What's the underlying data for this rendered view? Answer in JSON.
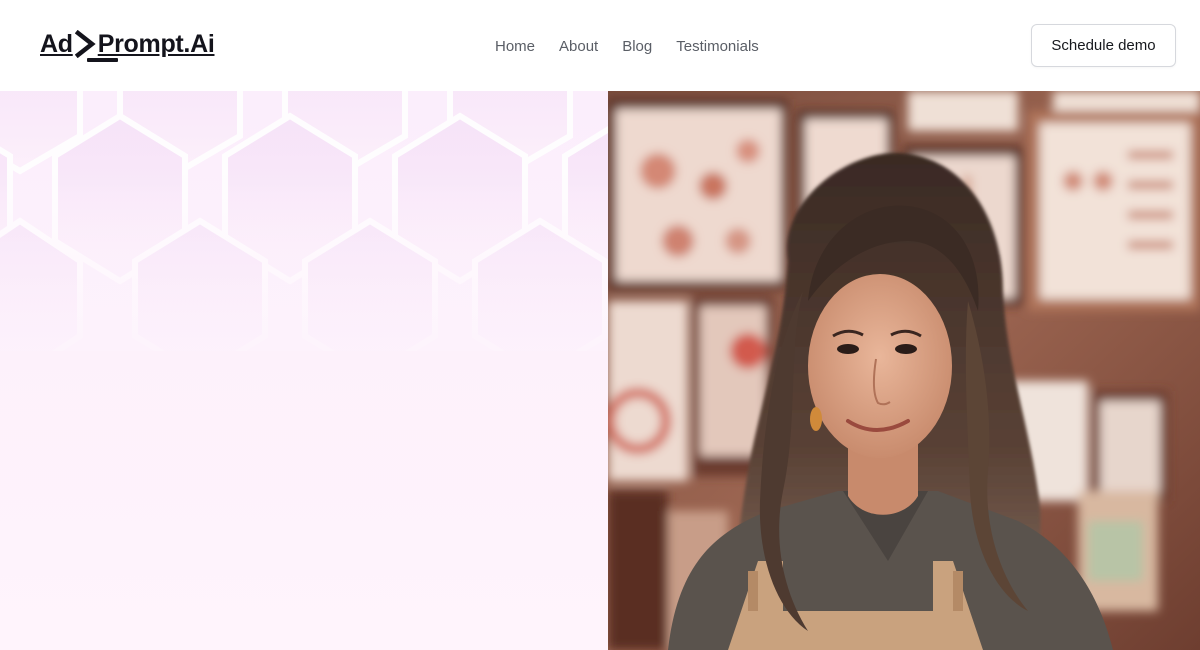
{
  "brand": {
    "name_part1": "Ad",
    "name_part2": "Prompt.Ai",
    "text_color": "#14141c"
  },
  "nav": {
    "items": [
      {
        "label": "Home"
      },
      {
        "label": "About"
      },
      {
        "label": "Blog"
      },
      {
        "label": "Testimonials"
      }
    ],
    "text_color": "#5a5e66"
  },
  "header": {
    "cta_label": "Schedule demo"
  },
  "hero": {
    "background_gradient": [
      "#fbeefc",
      "#fff4fc"
    ],
    "image_icon": "portrait-photo"
  }
}
